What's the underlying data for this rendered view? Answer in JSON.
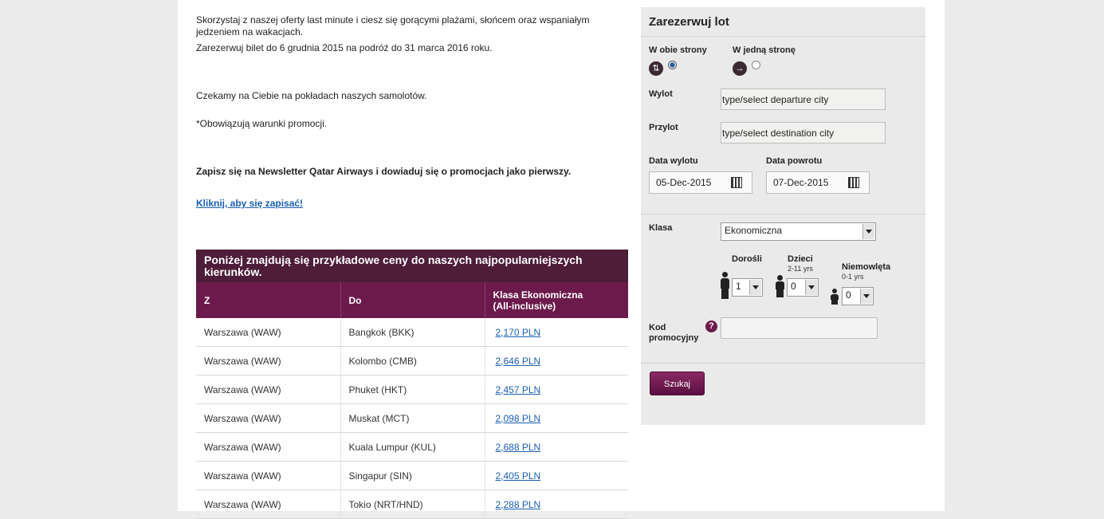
{
  "promo": {
    "p1": "Skorzystaj z naszej oferty last minute i ciesz się gorącymi plażami, słońcem oraz wspaniałym jedzeniem na wakacjach.",
    "p2": "Zarezerwuj bilet do 6 grudnia 2015 na podróż do 31 marca 2016 roku.",
    "p3": "Czekamy na Ciebie na pokładach naszych samolotów.",
    "p4": "*Obowiązują warunki promocji.",
    "newsletter": "Zapisz się na Newsletter Qatar Airways i dowiaduj się o promocjach jako pierwszy.",
    "subscribe_link": "Kliknij, aby się zapisać!"
  },
  "fares": {
    "title": "Poniżej znajdują się przykładowe ceny do naszych najpopularniejszych kierunków.",
    "headers": {
      "from": "Z",
      "to": "Do",
      "class": "Klasa Ekonomiczna",
      "class_note": "(All-inclusive)"
    },
    "rows": [
      {
        "from": "Warszawa (WAW)",
        "to": "Bangkok (BKK)",
        "price": "2,170 PLN"
      },
      {
        "from": "Warszawa (WAW)",
        "to": "Kolombo (CMB)",
        "price": "2,646 PLN"
      },
      {
        "from": "Warszawa (WAW)",
        "to": "Phuket (HKT)",
        "price": "2,457 PLN"
      },
      {
        "from": "Warszawa (WAW)",
        "to": "Muskat (MCT)",
        "price": "2,098 PLN"
      },
      {
        "from": "Warszawa (WAW)",
        "to": "Kuala Lumpur (KUL)",
        "price": "2,688 PLN"
      },
      {
        "from": "Warszawa (WAW)",
        "to": "Singapur (SIN)",
        "price": "2,405 PLN"
      },
      {
        "from": "Warszawa (WAW)",
        "to": "Tokio (NRT/HND)",
        "price": "2,288 PLN"
      }
    ]
  },
  "booking": {
    "title": "Zarezerwuj lot",
    "round_trip": "W obie strony",
    "one_way": "W jedną stronę",
    "trip_type_selected": "round_trip",
    "departure_label": "Wylot",
    "departure_placeholder": "type/select departure city",
    "arrival_label": "Przylot",
    "arrival_placeholder": "type/select destination city",
    "depart_date_label": "Data wylotu",
    "depart_date": "05-Dec-2015",
    "return_date_label": "Data powrotu",
    "return_date": "07-Dec-2015",
    "class_label": "Klasa",
    "class_value": "Ekonomiczna",
    "adults_label": "Dorośli",
    "adults_value": "1",
    "children_label": "Dzieci",
    "children_age": "2-11 yrs",
    "children_value": "0",
    "infants_label": "Niemowlęta",
    "infants_age": "0-1 yrs",
    "infants_value": "0",
    "promo_label_1": "Kod",
    "promo_label_2": "promocyjny",
    "promo_code": "",
    "help_icon": "?",
    "search_button": "Szukaj"
  },
  "colors": {
    "brand_dark": "#4d1d39",
    "brand": "#6c1a4b",
    "link": "#1a5fb4"
  }
}
